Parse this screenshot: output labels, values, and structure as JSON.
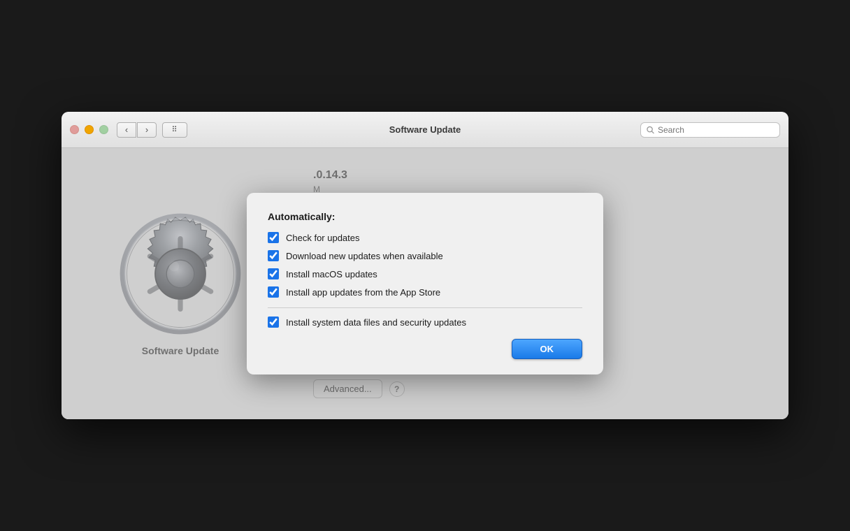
{
  "window": {
    "title": "Software Update",
    "search_placeholder": "Search"
  },
  "titlebar": {
    "back_label": "‹",
    "forward_label": "›",
    "grid_label": "⠿"
  },
  "left_panel": {
    "label": "Software Update"
  },
  "right_panel": {
    "version": ".0.14.3",
    "sub": "M"
  },
  "bottom_actions": {
    "advanced_label": "Advanced...",
    "help_label": "?"
  },
  "dialog": {
    "title": "Automatically:",
    "checkboxes": [
      {
        "id": "cb1",
        "label": "Check for updates",
        "checked": true
      },
      {
        "id": "cb2",
        "label": "Download new updates when available",
        "checked": true
      },
      {
        "id": "cb3",
        "label": "Install macOS updates",
        "checked": true
      },
      {
        "id": "cb4",
        "label": "Install app updates from the App Store",
        "checked": true
      },
      {
        "id": "cb5",
        "label": "Install system data files and security updates",
        "checked": true
      }
    ],
    "ok_label": "OK"
  }
}
